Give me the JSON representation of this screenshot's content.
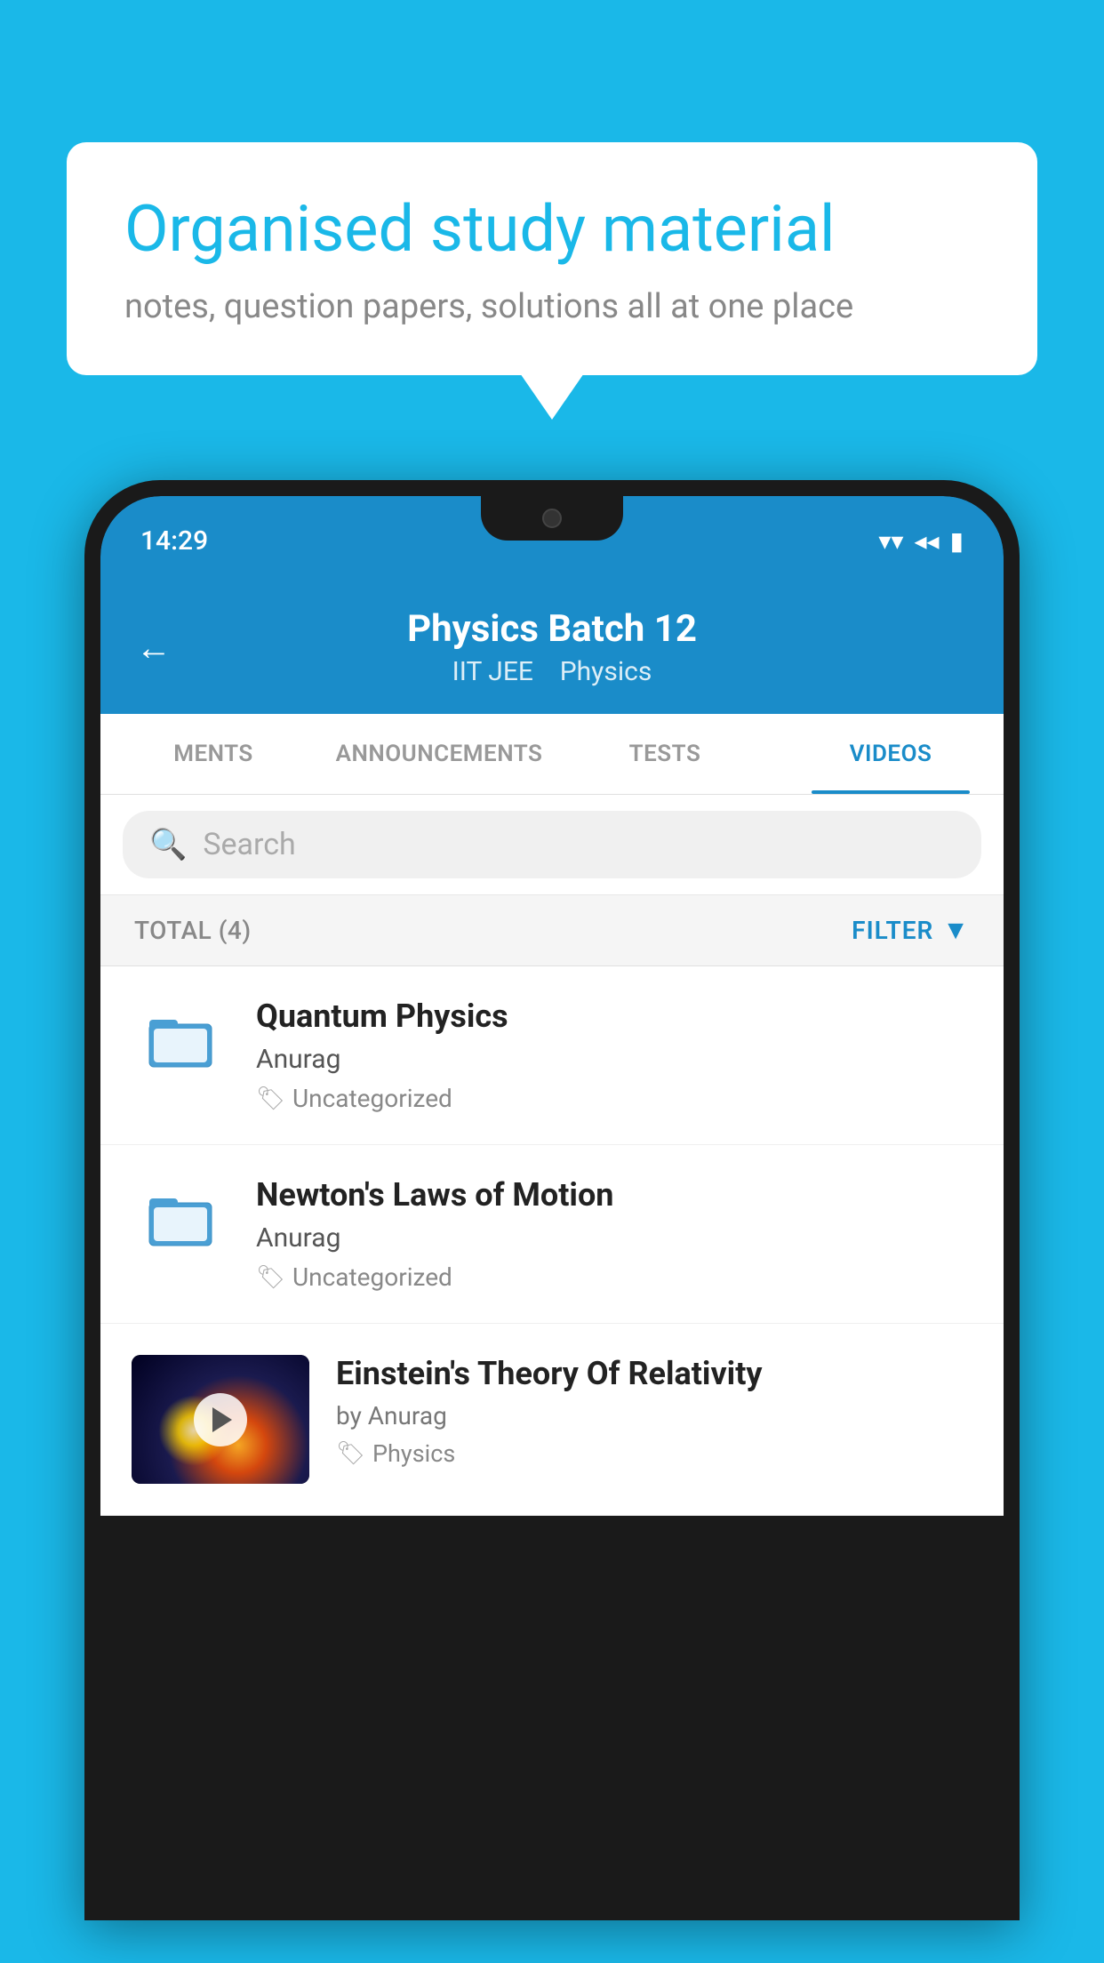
{
  "background_color": "#1ab8e8",
  "speech_bubble": {
    "title": "Organised study material",
    "subtitle": "notes, question papers, solutions all at one place"
  },
  "status_bar": {
    "time": "14:29",
    "wifi_icon": "▼",
    "signal_icon": "◄",
    "battery_icon": "▮"
  },
  "app_header": {
    "back_label": "←",
    "title": "Physics Batch 12",
    "subtitle_tag1": "IIT JEE",
    "subtitle_tag2": "Physics"
  },
  "tabs": [
    {
      "id": "ments",
      "label": "MENTS",
      "active": false
    },
    {
      "id": "announcements",
      "label": "ANNOUNCEMENTS",
      "active": false
    },
    {
      "id": "tests",
      "label": "TESTS",
      "active": false
    },
    {
      "id": "videos",
      "label": "VIDEOS",
      "active": true
    }
  ],
  "search": {
    "placeholder": "Search"
  },
  "filter_bar": {
    "total_label": "TOTAL (4)",
    "filter_label": "FILTER"
  },
  "videos": [
    {
      "id": "quantum",
      "title": "Quantum Physics",
      "author": "Anurag",
      "tag": "Uncategorized",
      "has_thumbnail": false
    },
    {
      "id": "newton",
      "title": "Newton's Laws of Motion",
      "author": "Anurag",
      "tag": "Uncategorized",
      "has_thumbnail": false
    },
    {
      "id": "einstein",
      "title": "Einstein's Theory Of Relativity",
      "author": "by Anurag",
      "tag": "Physics",
      "has_thumbnail": true
    }
  ]
}
